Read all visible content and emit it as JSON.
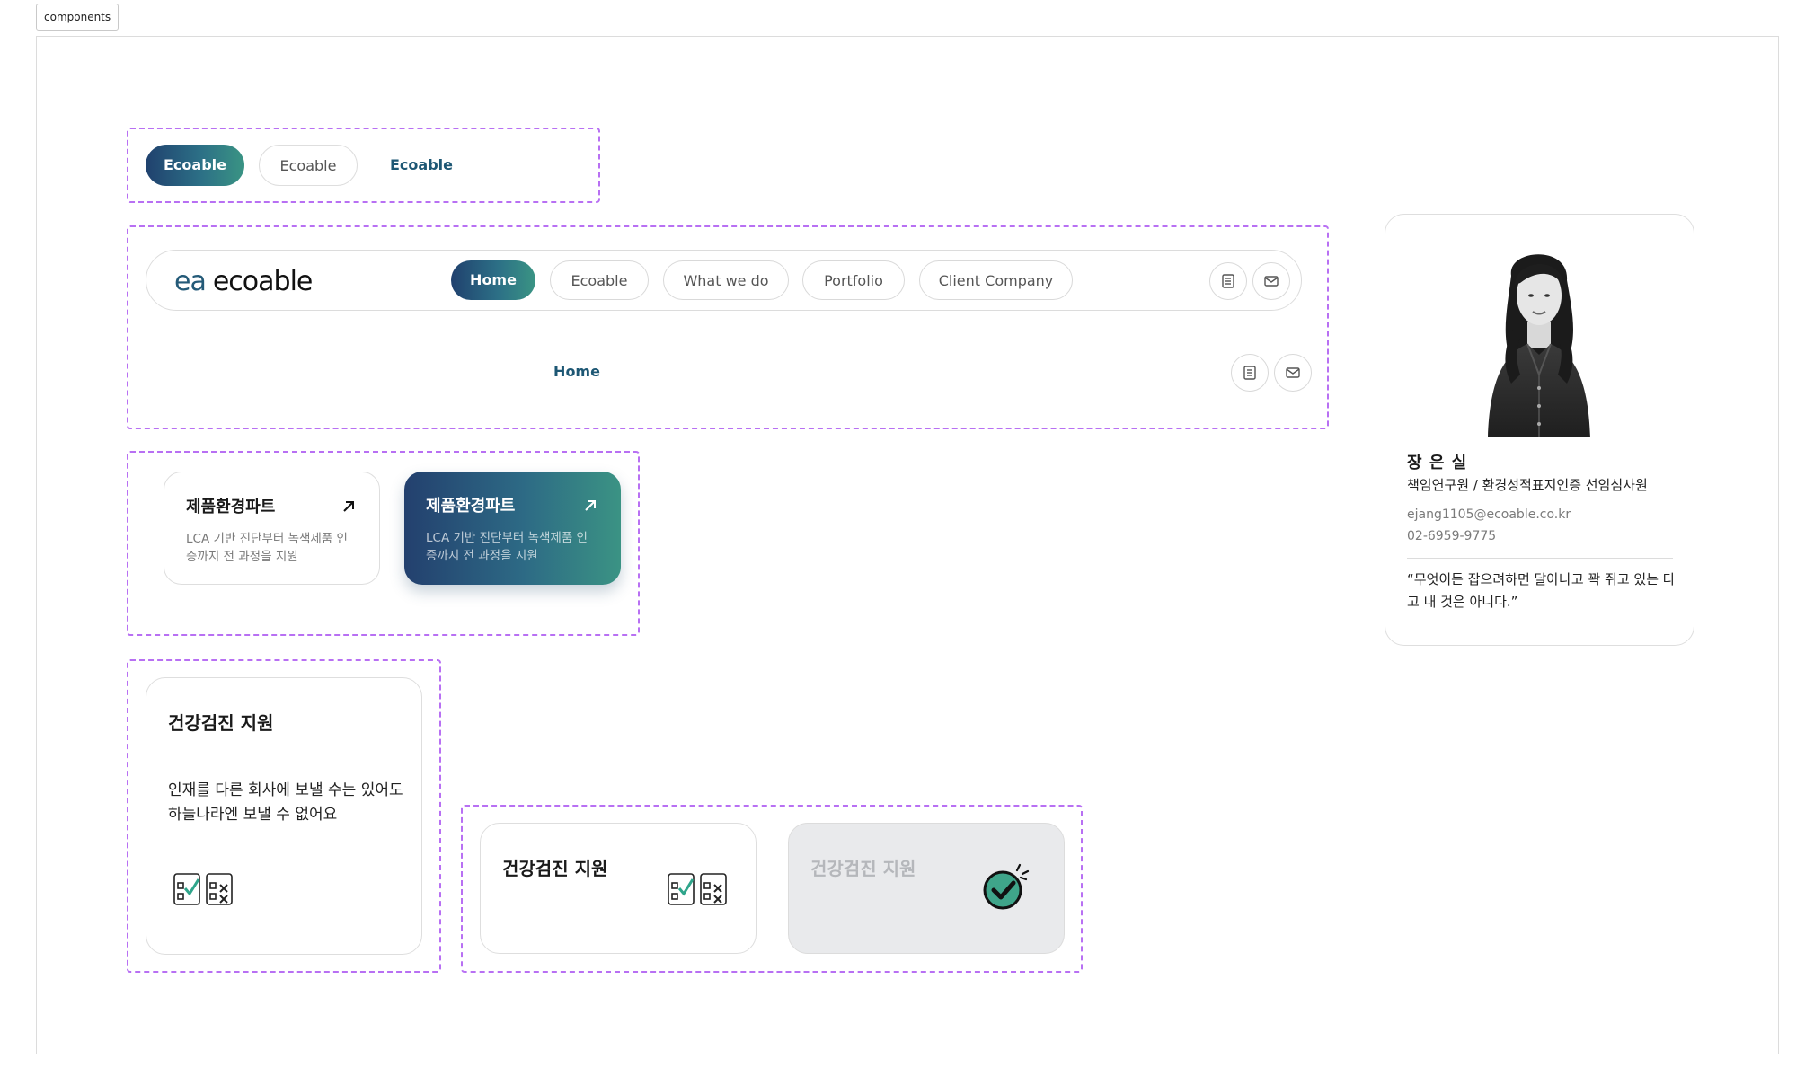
{
  "frame": {
    "label": "components"
  },
  "buttons": {
    "filled": "Ecoable",
    "outline": "Ecoable",
    "text": "Ecoable"
  },
  "navbar": {
    "logo_mark": "ea",
    "logo_text": "ecoable",
    "items": [
      "Home",
      "Ecoable",
      "What we do",
      "Portfolio",
      "Client Company"
    ],
    "active": "Home",
    "icons": [
      "document-icon",
      "mail-icon"
    ]
  },
  "mobile_nav": {
    "active": "Home",
    "icons": [
      "document-icon",
      "mail-icon"
    ]
  },
  "service_cards": [
    {
      "title": "제품환경파트",
      "desc": "LCA 기반 진단부터 녹색제품 인증까지 전 과정을 지원",
      "state": "default"
    },
    {
      "title": "제품환경파트",
      "desc": "LCA 기반 진단부터 녹색제품 인증까지 전 과정을 지원",
      "state": "active"
    }
  ],
  "benefit_card_large": {
    "title": "건강검진 지원",
    "desc": "인재를 다른 회사에 보낼 수는 있어도 하늘나라엔 보낼 수 없어요",
    "icon": "dos-donts-icon"
  },
  "benefit_cards_small": [
    {
      "title": "건강검진 지원",
      "icon": "dos-donts-icon",
      "state": "default"
    },
    {
      "title": "건강검진 지원",
      "icon": "check-circle-icon",
      "state": "disabled"
    }
  ],
  "profile": {
    "name": "장 은 실",
    "role": "책임연구원 / 환경성적표지인증 선임심사원",
    "email": "ejang1105@ecoable.co.kr",
    "phone": "02-6959-9775",
    "quote": "“무엇이든 잡으려하면 달아나고 꽉 쥐고 있는 다고 내 것은 아니다.”"
  },
  "colors": {
    "gradient_start": "#20416e",
    "gradient_end": "#3a9484",
    "text_teal": "#1d5774",
    "dash_border": "#b870f3",
    "disabled_bg": "#e9eaec"
  }
}
